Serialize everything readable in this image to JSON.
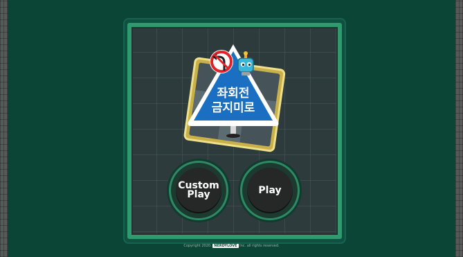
{
  "game": {
    "logo_line1": "좌회전",
    "logo_line2": "금지미로"
  },
  "menu": {
    "custom_play_line1": "Custom",
    "custom_play_line2": "Play",
    "play_label": "Play"
  },
  "footer": {
    "prefix": "Copyright 2020.",
    "brand": "NERDYLOVE",
    "suffix": "Inc. all rights reserved."
  },
  "colors": {
    "background": "#0a4535",
    "board_frame": "#2f9a6e",
    "sign_blue": "#1b6fc2",
    "no_turn_red": "#e0232a"
  },
  "icons": [
    "no-left-turn-icon",
    "robot-icon"
  ]
}
